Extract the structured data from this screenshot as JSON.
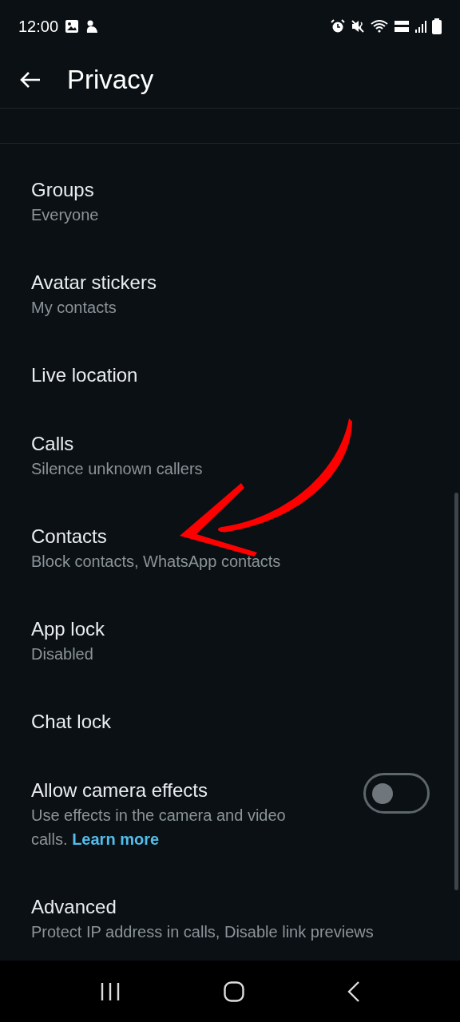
{
  "status_bar": {
    "time": "12:00"
  },
  "header": {
    "title": "Privacy"
  },
  "items": [
    {
      "kind": "link",
      "title": "Groups",
      "subtitle": "Everyone"
    },
    {
      "kind": "link",
      "title": "Avatar stickers",
      "subtitle": "My contacts"
    },
    {
      "kind": "link",
      "title": "Live location"
    },
    {
      "kind": "link",
      "title": "Calls",
      "subtitle": "Silence unknown callers"
    },
    {
      "kind": "link",
      "title": "Contacts",
      "subtitle": "Block contacts, WhatsApp contacts"
    },
    {
      "kind": "link",
      "title": "App lock",
      "subtitle": "Disabled"
    },
    {
      "kind": "link",
      "title": "Chat lock"
    },
    {
      "kind": "toggle",
      "title": "Allow camera effects",
      "subtitle": "Use effects in the camera and video calls.",
      "link": "Learn more",
      "on": false
    },
    {
      "kind": "link",
      "title": "Advanced",
      "subtitle": "Protect IP address in calls, Disable link previews"
    }
  ]
}
